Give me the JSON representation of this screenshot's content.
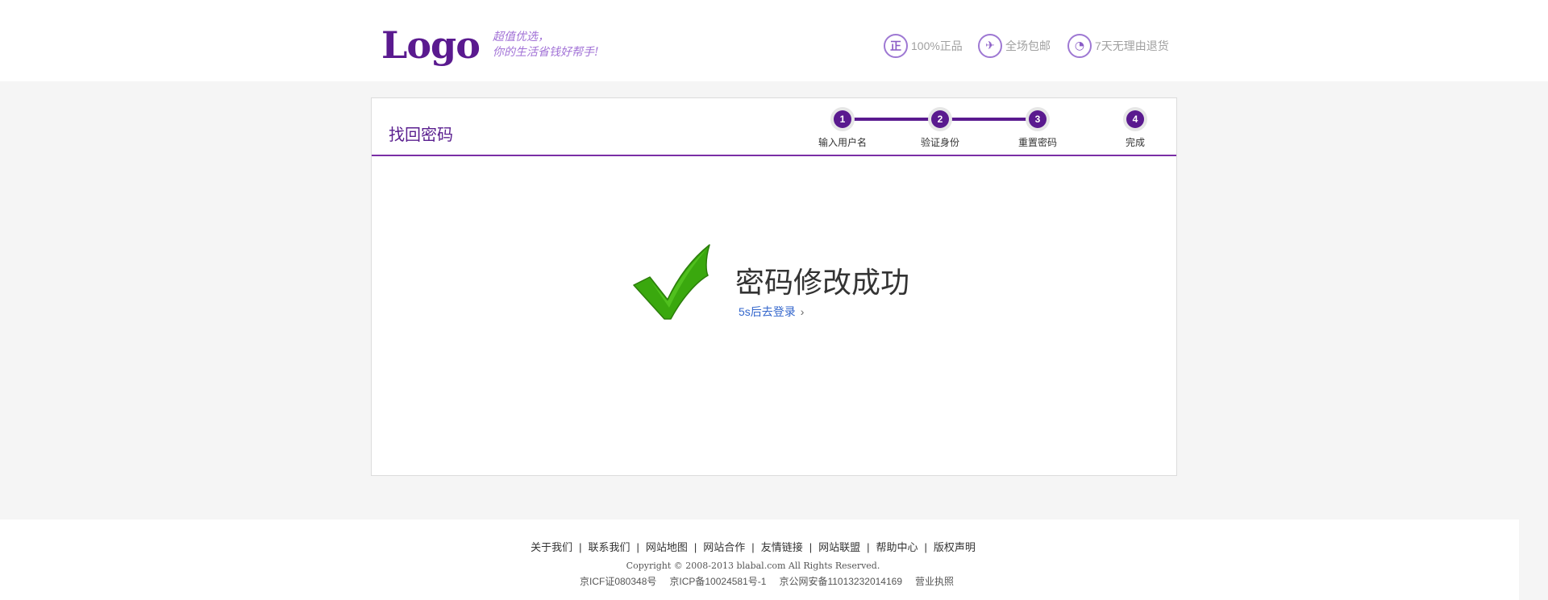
{
  "header": {
    "logo": "Logo",
    "slogan_line1": "超值优选，",
    "slogan_line2": "你的生活省钱好帮手!",
    "promises": [
      {
        "icon": "genuine-icon",
        "glyph": "正",
        "label": "100%正品"
      },
      {
        "icon": "shipping-icon",
        "glyph": "✈",
        "label": "全场包邮"
      },
      {
        "icon": "return-icon",
        "glyph": "◔",
        "label": "7天无理由退货"
      }
    ]
  },
  "panel": {
    "title": "找回密码",
    "steps": [
      {
        "num": "1",
        "label": "输入用户名"
      },
      {
        "num": "2",
        "label": "验证身份"
      },
      {
        "num": "3",
        "label": "重置密码"
      },
      {
        "num": "4",
        "label": "完成"
      }
    ],
    "success_title": "密码修改成功",
    "success_link": "5s后去登录",
    "link_chevron": "›"
  },
  "footer": {
    "links": [
      "关于我们",
      "联系我们",
      "网站地图",
      "网站合作",
      "友情链接",
      "网站联盟",
      "帮助中心",
      "版权声明"
    ],
    "copyright": "Copyright © 2008-2013 blabal.com All Rights Reserved.",
    "icp": [
      "京ICF证080348号",
      "京ICP备10024581号-1",
      "京公网安备11013232014169",
      "营业执照"
    ]
  },
  "colors": {
    "brand": "#5a1a8f",
    "accent": "#a171d6",
    "success": "#3aa80e",
    "link": "#3366cc"
  }
}
